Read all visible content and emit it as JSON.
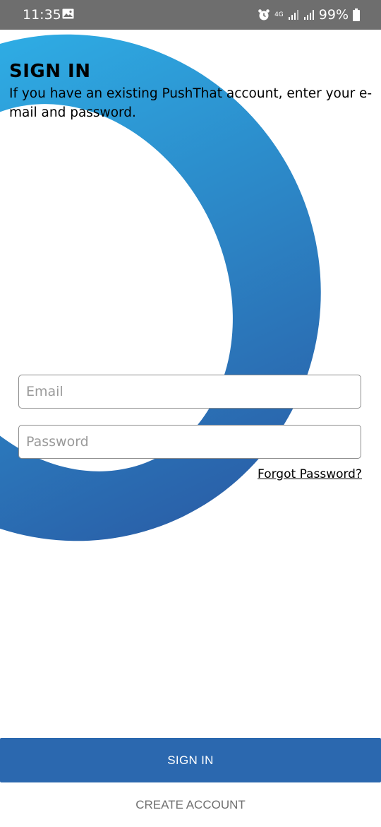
{
  "status_bar": {
    "time": "11:35",
    "network_type": "4G",
    "battery_percent": "99%",
    "icons": [
      "gallery-icon",
      "alarm-icon",
      "signal-icon",
      "battery-icon"
    ]
  },
  "header": {
    "title": "SIGN IN",
    "subtitle": "If you have an existing PushThat account, enter your e-mail and password."
  },
  "form": {
    "email_placeholder": "Email",
    "email_value": "",
    "password_placeholder": "Password",
    "password_value": "",
    "forgot_password_label": "Forgot Password?"
  },
  "actions": {
    "sign_in_label": "SIGN IN",
    "create_account_label": "CREATE ACCOUNT"
  },
  "colors": {
    "ring_top": "#2eace4",
    "ring_bottom": "#2a62aa",
    "primary_button": "#2b68af",
    "status_bar": "#6e6e6e"
  }
}
